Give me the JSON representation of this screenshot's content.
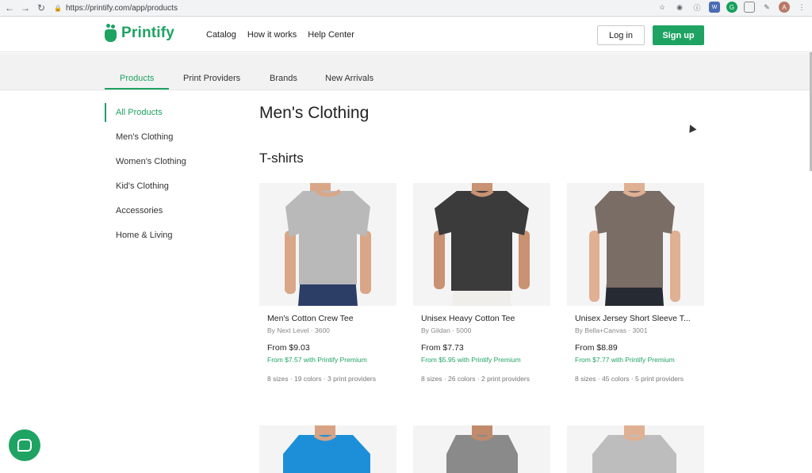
{
  "browser": {
    "url": "https://printify.com/app/products"
  },
  "header": {
    "logo_text": "Printify",
    "nav": [
      "Catalog",
      "How it works",
      "Help Center"
    ],
    "login_label": "Log in",
    "signup_label": "Sign up"
  },
  "tabs": [
    {
      "label": "Products",
      "active": true
    },
    {
      "label": "Print Providers",
      "active": false
    },
    {
      "label": "Brands",
      "active": false
    },
    {
      "label": "New Arrivals",
      "active": false
    }
  ],
  "sidebar": {
    "items": [
      {
        "label": "All Products",
        "active": true
      },
      {
        "label": "Men's Clothing",
        "active": false
      },
      {
        "label": "Women's Clothing",
        "active": false
      },
      {
        "label": "Kid's Clothing",
        "active": false
      },
      {
        "label": "Accessories",
        "active": false
      },
      {
        "label": "Home & Living",
        "active": false
      }
    ]
  },
  "main": {
    "title": "Men's Clothing",
    "section_title": "T-shirts",
    "products": [
      {
        "name": "Men's Cotton Crew Tee",
        "by": "By Next Level · 3600",
        "price": "From $9.03",
        "premium": "From $7.57 with Printify Premium",
        "meta": "8 sizes · 19 colors · 3 print providers",
        "shirt_color": "#b9b9b9",
        "pants_color": "#2c3e66"
      },
      {
        "name": "Unisex Heavy Cotton Tee",
        "by": "By Gildan · 5000",
        "price": "From $7.73",
        "premium": "From $5.95 with Printify Premium",
        "meta": "8 sizes · 26 colors · 2 print providers",
        "shirt_color": "#3b3b3b",
        "pants_color": "#efeeea"
      },
      {
        "name": "Unisex Jersey Short Sleeve T...",
        "by": "By Bella+Canvas · 3001",
        "price": "From $8.89",
        "premium": "From $7.77 with Printify Premium",
        "meta": "8 sizes · 45 colors · 5 print providers",
        "shirt_color": "#7a6d66",
        "pants_color": "#262a33"
      }
    ],
    "next_row_colors": [
      "#1c8fd8",
      "#8a8a8a",
      "#bdbdbd"
    ]
  },
  "colors": {
    "brand": "#1ea362"
  }
}
